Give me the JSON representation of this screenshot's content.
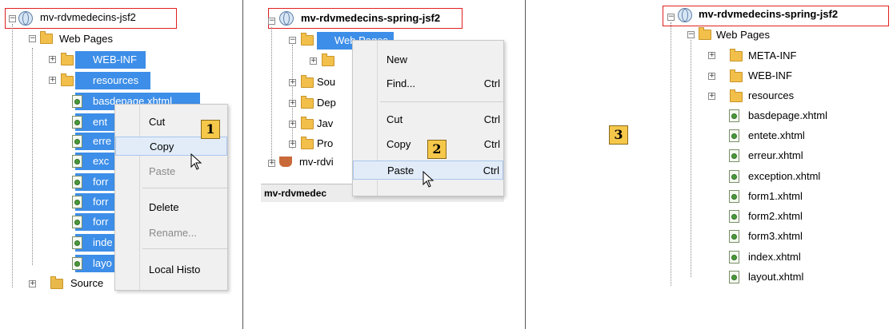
{
  "panel1": {
    "project": "mv-rdvmedecins-jsf2",
    "web_pages": "Web Pages",
    "items": [
      "WEB-INF",
      "resources",
      "basdepage.xhtml",
      "ent",
      "erre",
      "exc",
      "forr",
      "forr",
      "forr",
      "inde",
      "layo"
    ],
    "source": "Source",
    "menu": {
      "cut": "Cut",
      "copy": "Copy",
      "paste": "Paste",
      "delete": "Delete",
      "rename": "Rename...",
      "local_history": "Local Histo"
    },
    "badge": "1"
  },
  "panel2": {
    "project": "mv-rdvmedecins-spring-jsf2",
    "web_pages": "Web Pages",
    "items": [
      "Sou",
      "Dep",
      "Jav",
      "Pro"
    ],
    "sibling_project": "mv-rdvi",
    "bottom_bar": "mv-rdvmedec",
    "menu": {
      "new": "New",
      "find": "Find...",
      "find_sc": "Ctrl",
      "cut": "Cut",
      "cut_sc": "Ctrl",
      "copy": "Copy",
      "copy_sc": "Ctrl",
      "paste": "Paste",
      "paste_sc": "Ctrl"
    },
    "badge": "2"
  },
  "panel3": {
    "project": "mv-rdvmedecins-spring-jsf2",
    "web_pages": "Web Pages",
    "folders": [
      "META-INF",
      "WEB-INF",
      "resources"
    ],
    "files": [
      "basdepage.xhtml",
      "entete.xhtml",
      "erreur.xhtml",
      "exception.xhtml",
      "form1.xhtml",
      "form2.xhtml",
      "form3.xhtml",
      "index.xhtml",
      "layout.xhtml"
    ],
    "badge": "3"
  },
  "colors": {
    "selection": "#3d8ee8",
    "title_box": "#e02020",
    "badge": "#f6c84a"
  }
}
